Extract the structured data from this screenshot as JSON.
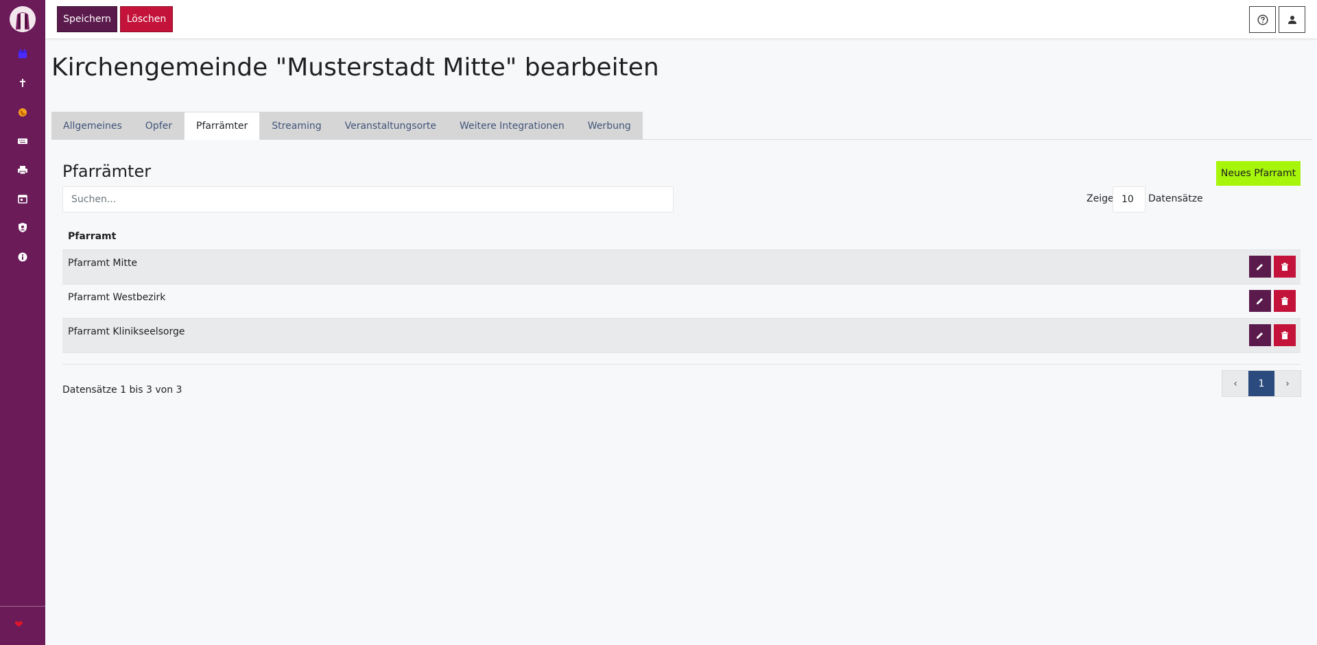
{
  "colors": {
    "sidebar": "#6a1b58",
    "primary": "#5b1a4c",
    "danger": "#c3133a",
    "accent_new": "#a6f50b",
    "pager_active": "#2b4a7e",
    "heart": "#e0162b"
  },
  "sidebar": {
    "logo_icon": "church-logo-icon",
    "items": [
      {
        "icon": "calendar-icon",
        "color": "#4b2bff"
      },
      {
        "icon": "cross-icon",
        "color": "#ffffff"
      },
      {
        "icon": "globe-icon",
        "color": "#f6a21e"
      },
      {
        "icon": "keyboard-icon",
        "color": "#ffffff"
      },
      {
        "icon": "printer-icon",
        "color": "#ffffff"
      },
      {
        "icon": "calendar-day-icon",
        "color": "#ffffff"
      },
      {
        "icon": "user-shield-icon",
        "color": "#ffffff"
      },
      {
        "icon": "info-icon",
        "color": "#ffffff"
      }
    ],
    "footer_icon": "heart-icon",
    "footer_glyph": "❤"
  },
  "toolbar": {
    "save_label": "Speichern",
    "delete_label": "Löschen",
    "help_icon": "help-icon",
    "user_icon": "user-icon"
  },
  "page": {
    "title": "Kirchengemeinde \"Musterstadt Mitte\" bearbeiten"
  },
  "tabs": [
    {
      "label": "Allgemeines",
      "active": false
    },
    {
      "label": "Opfer",
      "active": false
    },
    {
      "label": "Pfarrämter",
      "active": true
    },
    {
      "label": "Streaming",
      "active": false
    },
    {
      "label": "Veranstaltungsorte",
      "active": false
    },
    {
      "label": "Weitere Integrationen",
      "active": false
    },
    {
      "label": "Werbung",
      "active": false
    }
  ],
  "section": {
    "title": "Pfarrämter",
    "new_button": "Neues Pfarramt",
    "search_placeholder": "Suchen...",
    "length_pre": "Zeige",
    "length_value": "10",
    "length_post": "Datensätze"
  },
  "table": {
    "column_header": "Pfarramt",
    "rows": [
      {
        "name": "Pfarramt Mitte"
      },
      {
        "name": "Pfarramt Westbezirk"
      },
      {
        "name": "Pfarramt Klinikseelsorge"
      }
    ]
  },
  "footer": {
    "info": "Datensätze 1 bis 3 von 3",
    "pager": {
      "prev": "‹",
      "current": "1",
      "next": "›"
    }
  }
}
